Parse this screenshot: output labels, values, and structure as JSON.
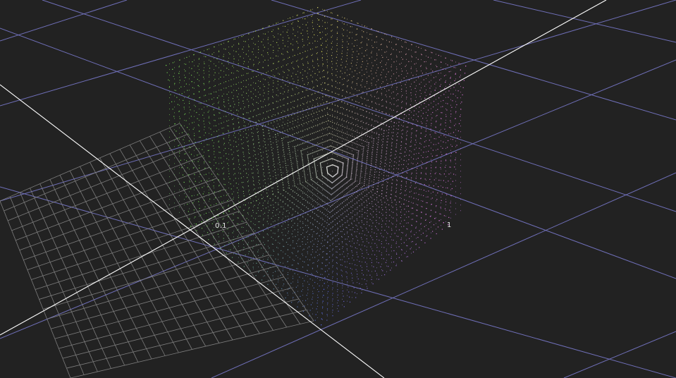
{
  "viewport": {
    "background": "#222222",
    "grid_color": "#6f6fb8",
    "fine_grid_color": "#b9b9b9",
    "axis_color": "#ffffff"
  },
  "axis_labels": {
    "tick_0_1": "0.1",
    "tick_1": "1"
  },
  "point_cloud": {
    "colorspace": "rgb-cube",
    "corner_colors": {
      "top": "#d8d850",
      "left": "#70d050",
      "right": "#d070d0",
      "bottom": "#5060d0",
      "center": "#e8e8e8"
    }
  }
}
